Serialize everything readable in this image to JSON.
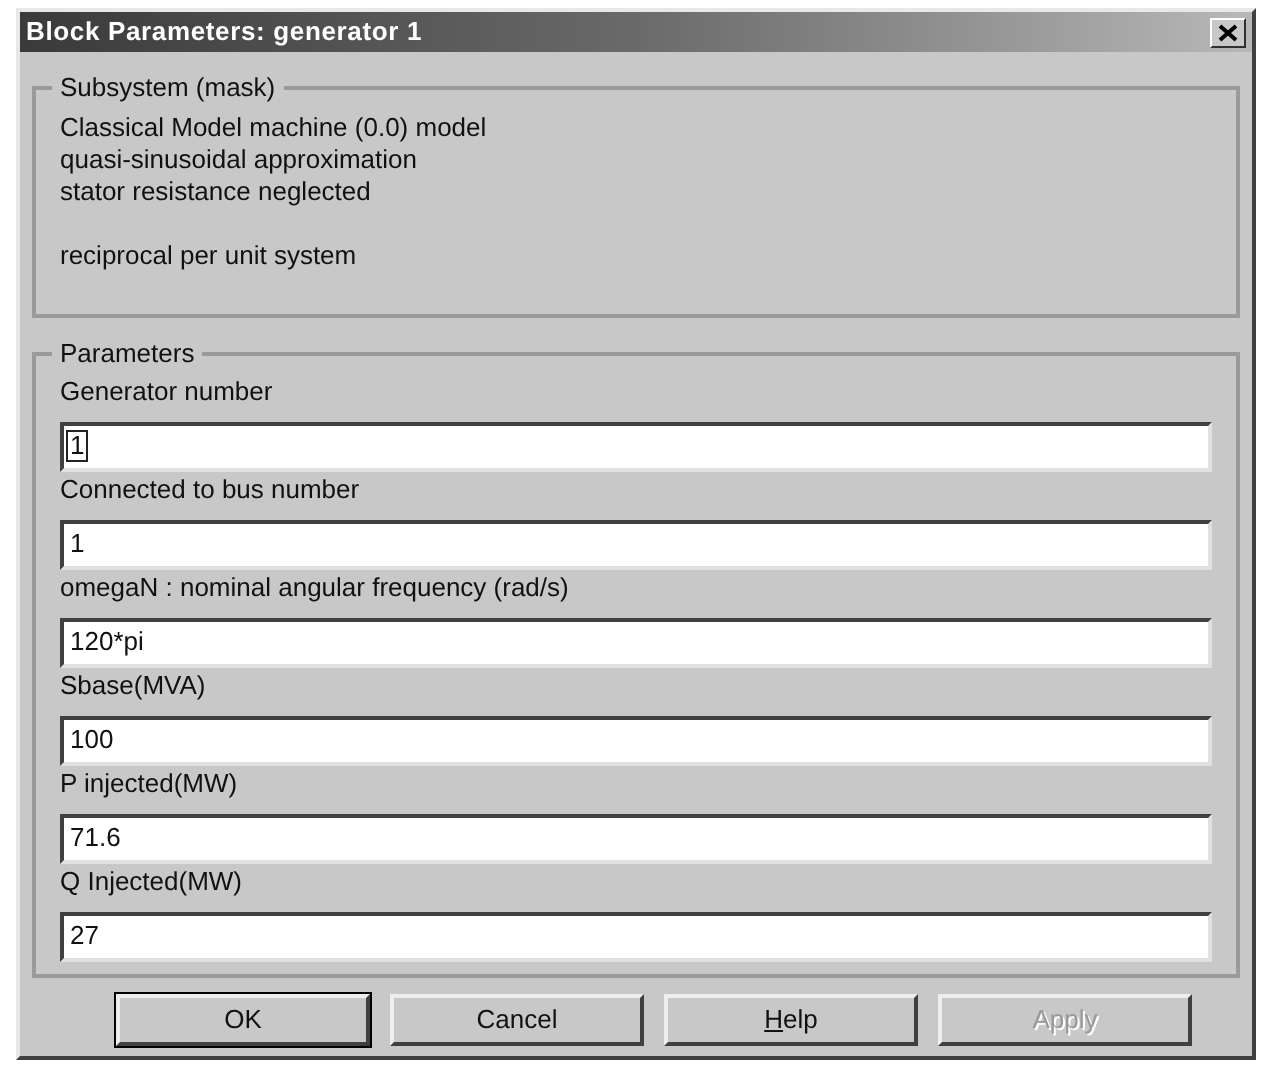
{
  "window": {
    "title": "Block Parameters: generator 1"
  },
  "mask": {
    "title": "Subsystem (mask)",
    "paragraphs": [
      [
        "Classical Model machine (0.0) model",
        "quasi-sinusoidal approximation",
        "stator resistance neglected"
      ],
      [
        "reciprocal per unit system"
      ]
    ]
  },
  "parameters": {
    "title": "Parameters",
    "fields": [
      {
        "label": "Generator number",
        "value": "1",
        "focused": true
      },
      {
        "label": "Connected to bus number",
        "value": "1",
        "focused": false
      },
      {
        "label": "omegaN : nominal angular frequency (rad/s)",
        "value": "120*pi",
        "focused": false
      },
      {
        "label": "Sbase(MVA)",
        "value": "100",
        "focused": false
      },
      {
        "label": "P injected(MW)",
        "value": "71.6",
        "focused": false
      },
      {
        "label": "Q Injected(MW)",
        "value": "27",
        "focused": false
      }
    ]
  },
  "buttons": [
    {
      "label": "OK",
      "default": true,
      "disabled": false,
      "mnemonic_underlined": false
    },
    {
      "label": "Cancel",
      "default": false,
      "disabled": false,
      "mnemonic_underlined": false
    },
    {
      "label": "Help",
      "default": false,
      "disabled": false,
      "mnemonic_underlined": true
    },
    {
      "label": "Apply",
      "default": false,
      "disabled": true,
      "mnemonic_underlined": false
    }
  ]
}
